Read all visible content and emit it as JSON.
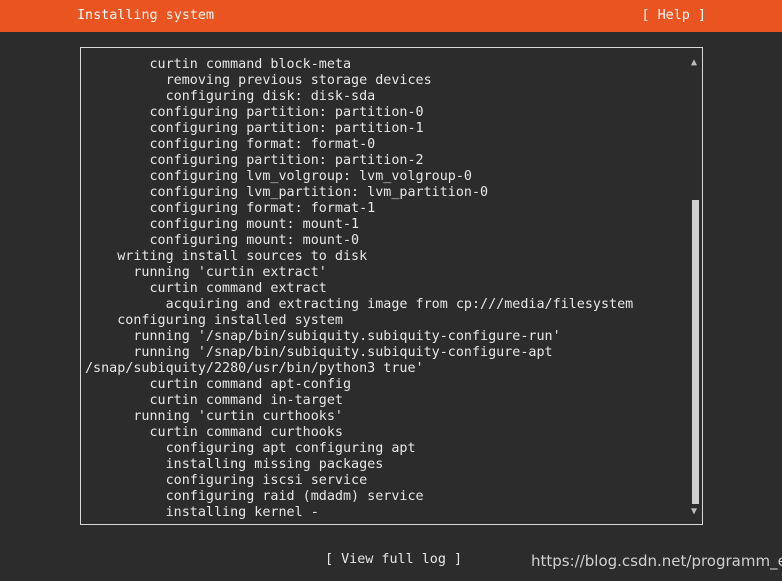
{
  "header": {
    "title": "Installing system",
    "help_label": "[ Help ]",
    "background": "#e95420"
  },
  "log": {
    "lines": [
      "        curtin command block-meta",
      "          removing previous storage devices",
      "          configuring disk: disk-sda",
      "        configuring partition: partition-0",
      "        configuring partition: partition-1",
      "        configuring format: format-0",
      "        configuring partition: partition-2",
      "        configuring lvm_volgroup: lvm_volgroup-0",
      "        configuring lvm_partition: lvm_partition-0",
      "        configuring format: format-1",
      "        configuring mount: mount-1",
      "        configuring mount: mount-0",
      "    writing install sources to disk",
      "      running 'curtin extract'",
      "        curtin command extract",
      "          acquiring and extracting image from cp:///media/filesystem",
      "    configuring installed system",
      "      running '/snap/bin/subiquity.subiquity-configure-run'",
      "      running '/snap/bin/subiquity.subiquity-configure-apt",
      "/snap/subiquity/2280/usr/bin/python3 true'",
      "        curtin command apt-config",
      "        curtin command in-target",
      "      running 'curtin curthooks'",
      "        curtin command curthooks",
      "          configuring apt configuring apt",
      "          installing missing packages",
      "          configuring iscsi service",
      "          configuring raid (mdadm) service",
      "          installing kernel -"
    ],
    "scroll_up_icon": "▲",
    "scroll_down_icon": "▼"
  },
  "footer": {
    "view_log_label": "[ View full log ]"
  },
  "watermark": {
    "text": "https://blog.csdn.net/programm_er"
  }
}
